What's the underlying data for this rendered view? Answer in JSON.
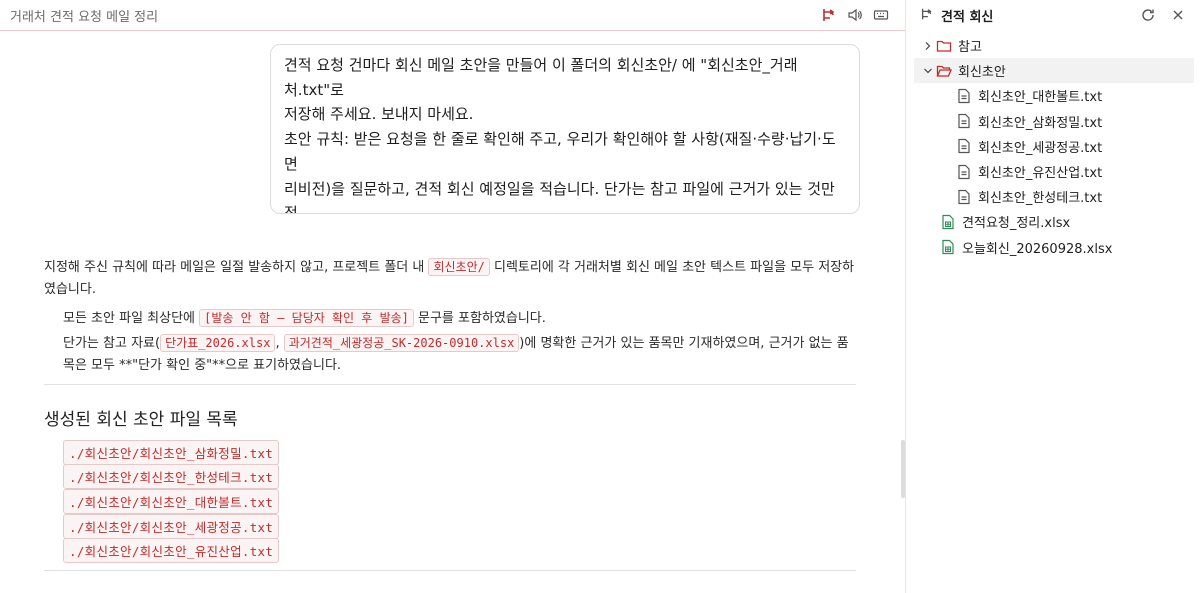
{
  "chat": {
    "title": "거래처 견적 요청 메일 정리",
    "header_icons": [
      "branch-icon",
      "speaker-icon",
      "keyboard-icon"
    ],
    "user_message": "견적 요청 건마다 회신 메일 초안을 만들어 이 폴더의 회신초안/ 에 \"회신초안_거래처.txt\"로\n저장해 주세요. 보내지 마세요.\n초안 규칙: 받은 요청을 한 줄로 확인해 주고, 우리가 확인해야 할 사항(재질·수량·납기·도면\n리비전)을 질문하고, 견적 회신 예정일을 적습니다. 단가는 참고 파일에 근거가 있는 것만 적\n고 없으면 \"단가 확인 중\"으로 둡니다. 맨 위에 \"[발송 안 함 — 담당자 확인 후 발송]\"을 적어\n주세요. 다 만든 뒤 어느 건에 어떤 확인이 필요한지 표로 요약해 주세요.",
    "answer": {
      "p1_before": "지정해 주신 규칙에 따라 메일은 일절 발송하지 않고, 프로젝트 폴더 내 ",
      "p1_code": "회신초안/",
      "p1_after": " 디렉토리에 각 거래처별 회신 메일 초안 텍스트 파일을 모두 저장하였습니다.",
      "b1_before": "모든 초안 파일 최상단에 ",
      "b1_code": "[발송 안 함 — 담당자 확인 후 발송]",
      "b1_after": " 문구를 포함하였습니다.",
      "b2_before": "단가는 참고 자료(",
      "b2_code1": "단가표_2026.xlsx",
      "b2_sep": ", ",
      "b2_code2": "과거견적_세광정공_SK-2026-0910.xlsx",
      "b2_after": ")에 명확한 근거가 있는 품목만 기재하였으며, 근거가 없는 품목은 모두 **\"단가 확인 중\"**으로 표기하였습니다.",
      "section_title": "생성된 회신 초안 파일 목록",
      "files": [
        "./회신초안/회신초안_삼화정밀.txt",
        "./회신초안/회신초안_한성테크.txt",
        "./회신초안/회신초안_대한볼트.txt",
        "./회신초안/회신초안_세광정공.txt",
        "./회신초안/회신초안_유진산업.txt"
      ]
    }
  },
  "explorer": {
    "title": "견적 회신",
    "refresh_icon": "refresh-icon",
    "close_icon": "close-icon",
    "tree": [
      {
        "label": "참고",
        "type": "folder",
        "expanded": false
      },
      {
        "label": "회신초안",
        "type": "folder",
        "expanded": true
      },
      {
        "label": "회신초안_대한볼트.txt",
        "type": "file"
      },
      {
        "label": "회신초안_삼화정밀.txt",
        "type": "file"
      },
      {
        "label": "회신초안_세광정공.txt",
        "type": "file"
      },
      {
        "label": "회신초안_유진산업.txt",
        "type": "file"
      },
      {
        "label": "회신초안_한성테크.txt",
        "type": "file"
      },
      {
        "label": "견적요청_정리.xlsx",
        "type": "sheet"
      },
      {
        "label": "오늘회신_20260928.xlsx",
        "type": "sheet"
      }
    ]
  },
  "colors": {
    "accent": "#c42b2b",
    "code_bg": "#fbf4f4",
    "folder": "#c42b2b",
    "sheet": "#2e8b57",
    "header_rule": "#f0c8cc"
  }
}
